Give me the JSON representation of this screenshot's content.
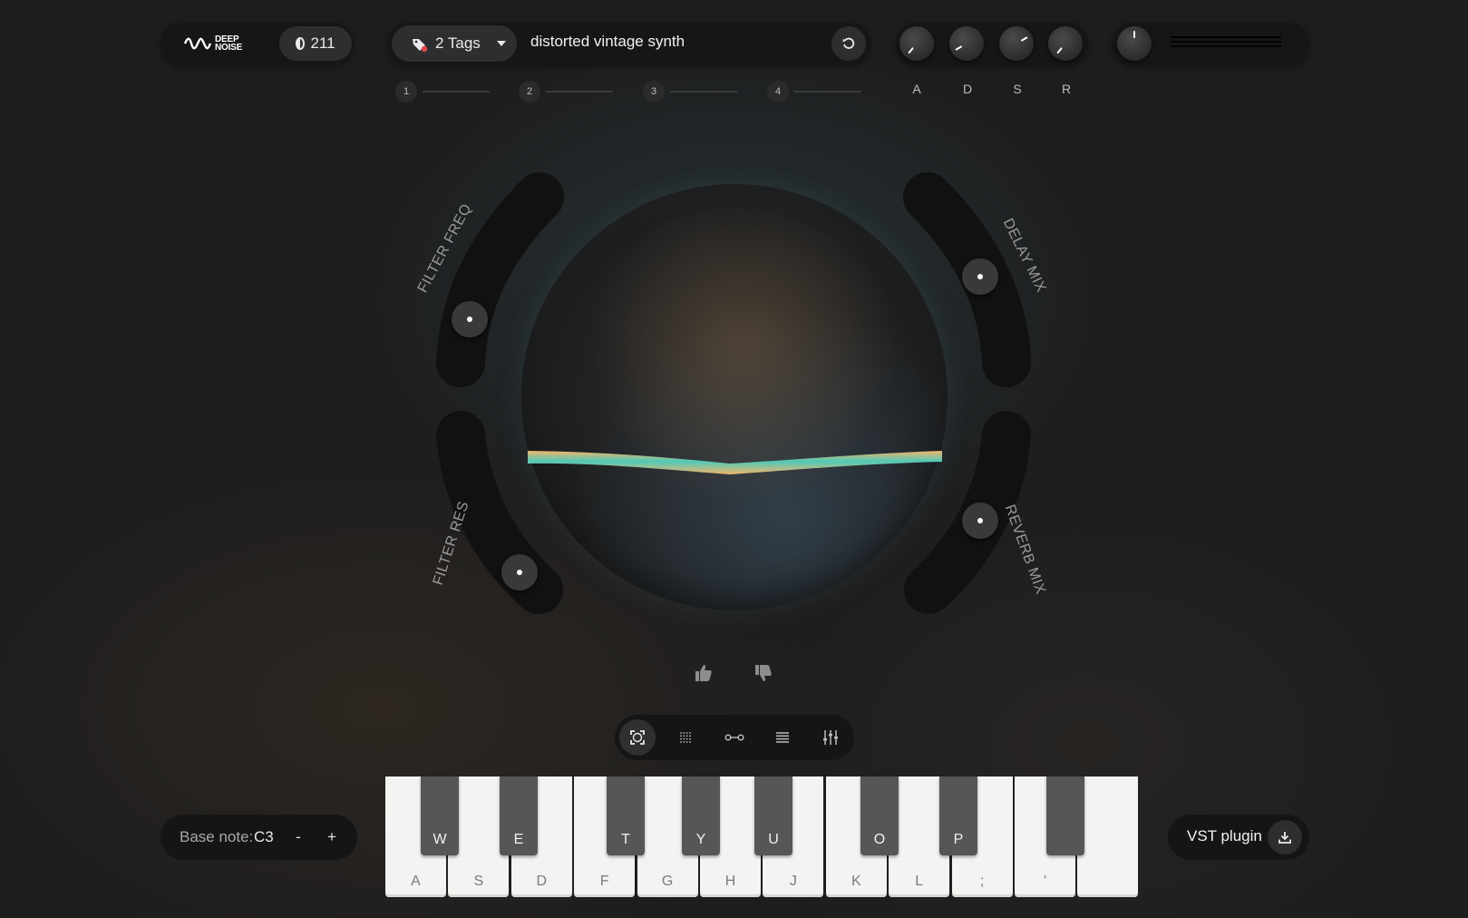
{
  "header": {
    "logo_lines": [
      "DEEP",
      "NOISE"
    ],
    "credits": "211",
    "tags_label": "2 Tags",
    "prompt": "distorted vintage synth"
  },
  "slots": [
    "1",
    "2",
    "3",
    "4"
  ],
  "envelope": {
    "labels": [
      "A",
      "D",
      "S",
      "R"
    ]
  },
  "arcs": {
    "filter_freq": "FILTER FREQ",
    "filter_res": "FILTER RES",
    "delay_mix": "DELAY MIX",
    "reverb_mix": "REVERB MIX"
  },
  "base_note": {
    "label": "Base note:",
    "value": "C3",
    "minus": "-",
    "plus": "+"
  },
  "keyboard": {
    "white_keys": [
      "A",
      "S",
      "D",
      "F",
      "G",
      "H",
      "J",
      "K",
      "L",
      ";",
      "'",
      ""
    ],
    "black_keys": [
      "W",
      "E",
      "T",
      "Y",
      "U",
      "O",
      "P",
      ""
    ]
  },
  "vst": {
    "label": "VST plugin"
  },
  "colors": {
    "wave_orange": "#f3b56b",
    "wave_teal": "#4fc9b8",
    "tag_dot": "#e0454b"
  },
  "icons": {
    "tag": "tag-icon",
    "reset": "refresh-icon",
    "thumb_up": "thumbs-up-icon",
    "thumb_down": "thumbs-down-icon",
    "toolbar": [
      "orb-view-icon",
      "grid-view-icon",
      "link-view-icon",
      "list-view-icon",
      "sliders-view-icon"
    ],
    "download": "download-icon"
  }
}
